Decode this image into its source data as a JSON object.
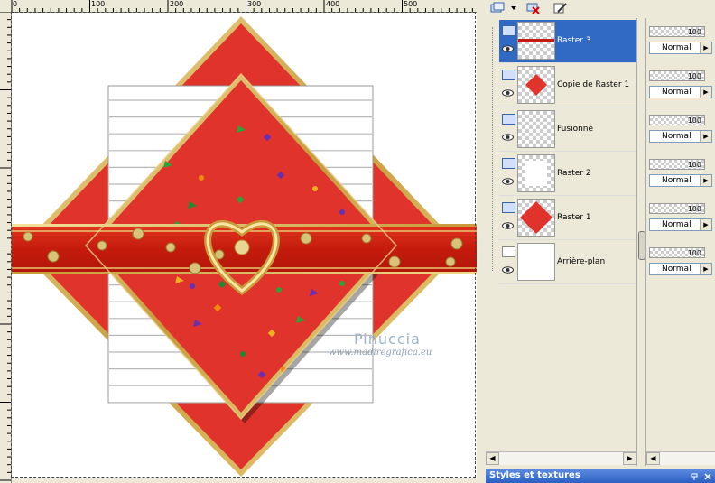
{
  "ruler": {
    "top_labels": [
      "0",
      "100",
      "200",
      "300",
      "400",
      "500"
    ]
  },
  "canvas": {
    "watermark_name": "Pinuccia",
    "watermark_url": "www.madiregrafica.eu",
    "colors": {
      "red": "#e0332c",
      "dark_red": "#c11a0e",
      "gold": "#d9b75a",
      "white": "#ffffff",
      "stripe": "#b8b8b8"
    }
  },
  "layers": [
    {
      "name": "Raster 3",
      "selected": true,
      "opacity": "100",
      "blend": "Normal",
      "thumb": "ribbon"
    },
    {
      "name": "Copie de Raster 1",
      "selected": false,
      "opacity": "100",
      "blend": "Normal",
      "thumb": "diamond-small"
    },
    {
      "name": "Fusionné",
      "selected": false,
      "opacity": "100",
      "blend": "Normal",
      "thumb": "transparent"
    },
    {
      "name": "Raster 2",
      "selected": false,
      "opacity": "100",
      "blend": "Normal",
      "thumb": "white-rect"
    },
    {
      "name": "Raster 1",
      "selected": false,
      "opacity": "100",
      "blend": "Normal",
      "thumb": "diamond"
    },
    {
      "name": "Arrière-plan",
      "selected": false,
      "opacity": "100",
      "blend": "Normal",
      "thumb": "white"
    }
  ],
  "styles_panel": {
    "title": "Styles et textures"
  },
  "icons": {
    "toolbar": [
      "new-layer-icon",
      "delete-layer-icon",
      "edit-layer-icon"
    ]
  }
}
